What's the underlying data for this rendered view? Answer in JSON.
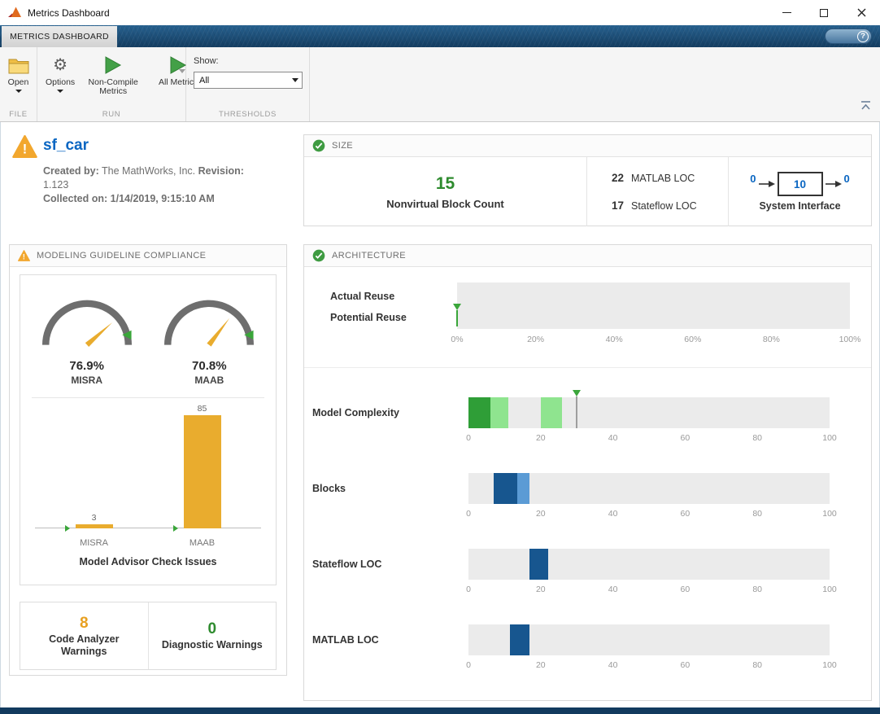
{
  "window": {
    "title": "Metrics Dashboard"
  },
  "tabstrip": {
    "tab": "METRICS DASHBOARD",
    "help": "?"
  },
  "toolbar": {
    "open_label": "Open",
    "options_label": "Options",
    "non_compile_label": "Non-Compile Metrics",
    "all_metrics_label": "All Metrics",
    "show_label": "Show:",
    "show_value": "All",
    "section_file": "FILE",
    "section_run": "RUN",
    "section_thresholds": "THRESHOLDS"
  },
  "icons": {
    "app": "matlab-logo",
    "open": "folder",
    "options": "gear",
    "non_compile": "green-play",
    "all_metrics": "green-play",
    "help": "question-mark",
    "status_ok": "green-check-circle",
    "status_warning": "orange-warning-triangle"
  },
  "model": {
    "name": "sf_car",
    "created_by_label": "Created by:",
    "created_by": "The MathWorks, Inc.",
    "revision_label": "Revision:",
    "revision": "1.123",
    "collected_label": "Collected on:",
    "collected": "1/14/2019, 9:15:10 AM"
  },
  "size_panel": {
    "title": "SIZE",
    "nonvirtual_count": "15",
    "nonvirtual_label": "Nonvirtual Block Count",
    "matlab_loc": "22",
    "matlab_loc_label": "MATLAB LOC",
    "stateflow_loc": "17",
    "stateflow_loc_label": "Stateflow LOC",
    "interface": {
      "input": "0",
      "value": "10",
      "output": "0",
      "label": "System Interface"
    }
  },
  "compliance_panel": {
    "title": "MODELING GUIDELINE COMPLIANCE",
    "gauges": [
      {
        "value_text": "76.9%",
        "percent": 76.9,
        "label": "MISRA"
      },
      {
        "value_text": "70.8%",
        "percent": 70.8,
        "label": "MAAB"
      }
    ],
    "bar_chart": {
      "type": "bar",
      "categories": [
        "MISRA",
        "MAAB"
      ],
      "values": [
        3,
        85
      ],
      "ymax": 92,
      "title": "Model Advisor Check Issues",
      "bar_color": "#E9AC2E"
    },
    "warnings": [
      {
        "value": "8",
        "label": "Code Analyzer Warnings",
        "color": "#E8A020"
      },
      {
        "value": "0",
        "label": "Diagnostic Warnings",
        "color": "#2E8B2E"
      }
    ]
  },
  "architecture_panel": {
    "title": "ARCHITECTURE",
    "reuse": {
      "rows": [
        "Actual Reuse",
        "Potential Reuse"
      ],
      "axis": [
        "0%",
        "20%",
        "40%",
        "60%",
        "80%",
        "100%"
      ],
      "marker_percent": 0
    },
    "axis": [
      "0",
      "20",
      "40",
      "60",
      "80",
      "100"
    ],
    "metrics": [
      {
        "label": "Model Complexity",
        "marker": 30,
        "segments": [
          {
            "start": 0,
            "end": 6,
            "color": "#2F9E37"
          },
          {
            "start": 6,
            "end": 11,
            "color": "#8FE48F"
          },
          {
            "start": 20,
            "end": 26,
            "color": "#8FE48F"
          }
        ]
      },
      {
        "label": "Blocks",
        "segments": [
          {
            "start": 7,
            "end": 13.5,
            "color": "#17568F"
          },
          {
            "start": 13.5,
            "end": 17,
            "color": "#5B9BD5"
          }
        ]
      },
      {
        "label": "Stateflow LOC",
        "segments": [
          {
            "start": 17,
            "end": 22,
            "color": "#17568F"
          }
        ]
      },
      {
        "label": "MATLAB LOC",
        "segments": [
          {
            "start": 11.5,
            "end": 17,
            "color": "#17568F"
          }
        ]
      }
    ]
  },
  "colors": {
    "accent_green": "#2E8B2E",
    "warning_yellow": "#E9AC2E",
    "link_blue": "#0A66C2"
  }
}
